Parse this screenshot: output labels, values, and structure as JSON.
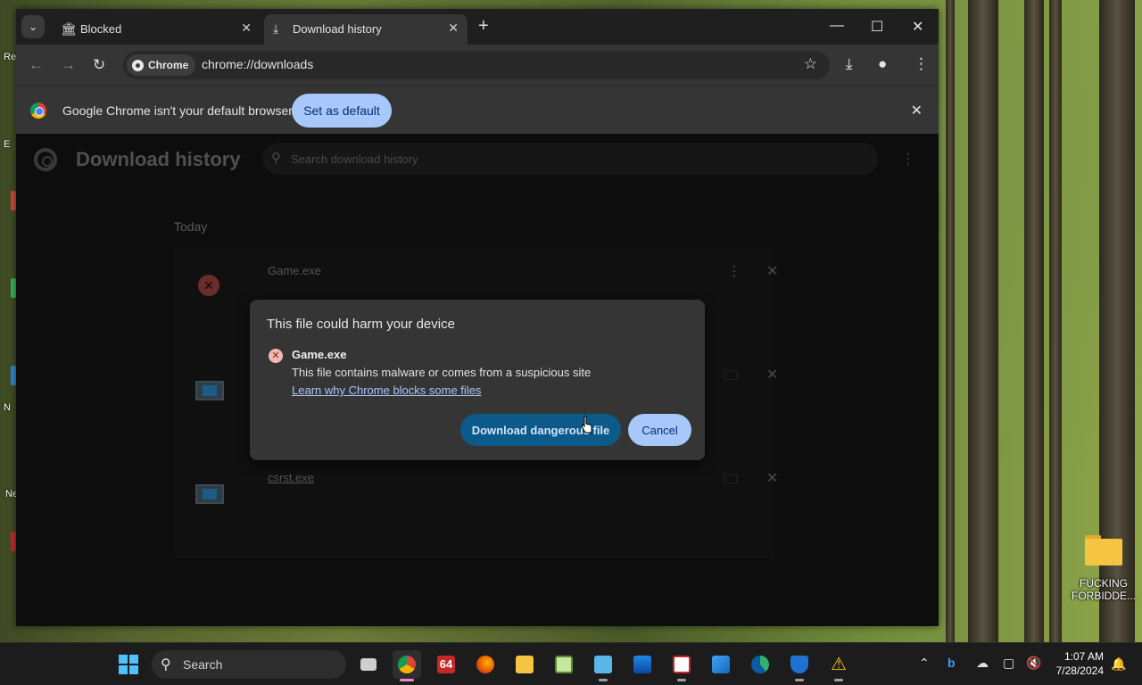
{
  "browser": {
    "tabs": [
      {
        "title": "Blocked",
        "icon": "bank-icon",
        "active": false
      },
      {
        "title": "Download history",
        "icon": "download-icon",
        "active": true
      }
    ],
    "omnibox": {
      "chip_label": "Chrome",
      "url": "chrome://downloads"
    },
    "infobar": {
      "message": "Google Chrome isn't your default browser",
      "button_label": "Set as default"
    }
  },
  "downloads_page": {
    "title": "Download history",
    "search_placeholder": "Search download history",
    "date_group": "Today",
    "items": [
      {
        "name": "Game.exe",
        "status": "dangerous"
      },
      {
        "name": "",
        "status": "complete"
      },
      {
        "name": "csrst.exe",
        "status": "complete"
      }
    ]
  },
  "dialog": {
    "title": "This file could harm your device",
    "filename": "Game.exe",
    "description": "This file contains malware or comes from a suspicious site",
    "link": "Learn why Chrome blocks some files",
    "confirm_label": "Download dangerous file",
    "cancel_label": "Cancel"
  },
  "desktop": {
    "edge_fragments": [
      "Re",
      "E",
      "N",
      "Ne"
    ],
    "folder_label": "FUCKING FORBIDDE..."
  },
  "taskbar": {
    "search_label": "Search",
    "app_64_label": "64",
    "time": "1:07 AM",
    "date": "7/28/2024"
  },
  "colors": {
    "accent": "#a8c7fa",
    "danger_button": "#0b5a8a",
    "danger_icon": "#f2b8b5",
    "windows_blue": "#4cc2ff"
  }
}
